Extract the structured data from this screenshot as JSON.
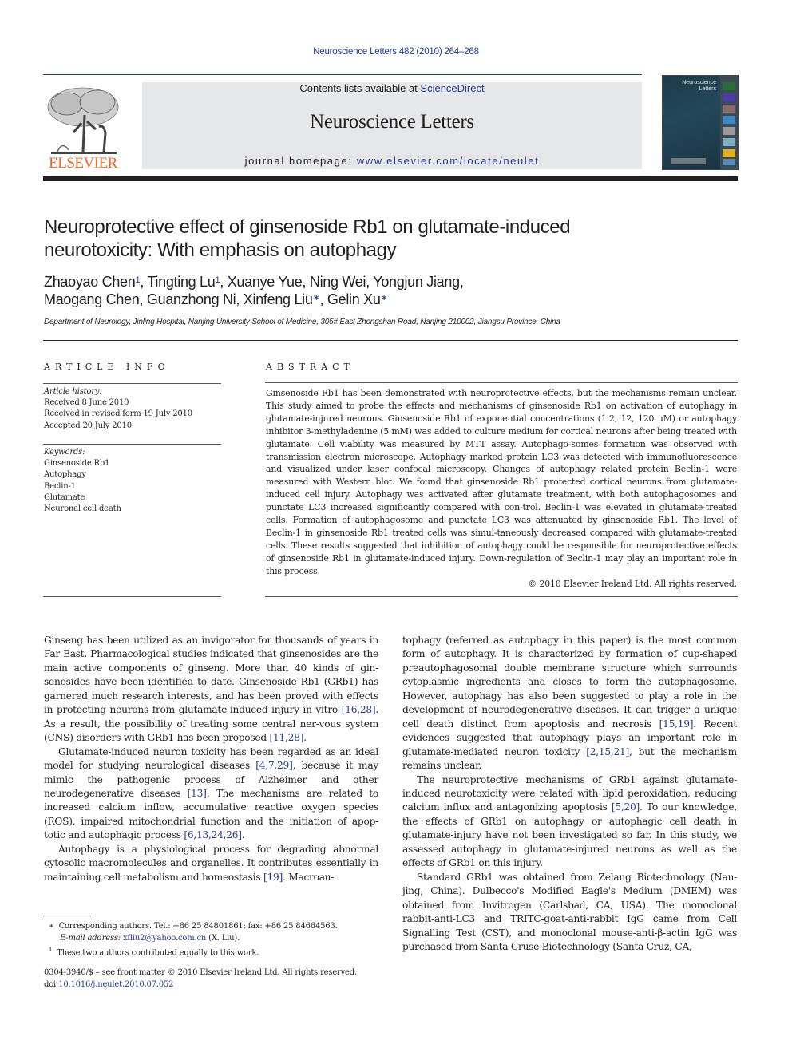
{
  "header": {
    "citation": "Neuroscience Letters 482 (2010) 264–268",
    "contents_prefix": "Contents lists available at ",
    "contents_link": "ScienceDirect",
    "journal_name": "Neuroscience Letters",
    "homepage_prefix": "journal homepage: ",
    "homepage_link": "www.elsevier.com/locate/neulet",
    "publisher_logo_text": "ELSEVIER",
    "cover_title_line1": "Neuroscience",
    "cover_title_line2": "Letters",
    "colors": {
      "link": "#2b3990",
      "publisher": "#f26522",
      "masthead_bg": "#e6e7e8"
    }
  },
  "article": {
    "title_line1": "Neuroprotective effect of ginsenoside Rb1 on glutamate-induced",
    "title_line2": "neurotoxicity: With emphasis on autophagy",
    "authors": [
      {
        "name": "Zhaoyao Chen",
        "mark": "1"
      },
      {
        "name": "Tingting Lu",
        "mark": "1"
      },
      {
        "name": "Xuanye Yue",
        "mark": ""
      },
      {
        "name": "Ning Wei",
        "mark": ""
      },
      {
        "name": "Yongjun Jiang",
        "mark": ""
      },
      {
        "name": "Maogang Chen",
        "mark": ""
      },
      {
        "name": "Guanzhong Ni",
        "mark": ""
      },
      {
        "name": "Xinfeng Liu",
        "mark": "∗"
      },
      {
        "name": "Gelin Xu",
        "mark": "∗"
      }
    ],
    "affiliation": "Department of Neurology, Jinling Hospital, Nanjing University School of Medicine, 305# East Zhongshan Road, Nanjing 210002, Jiangsu Province, China"
  },
  "article_info": {
    "heading": "ARTICLE INFO",
    "history_label": "Article history:",
    "history": [
      "Received 8 June 2010",
      "Received in revised form 19 July 2010",
      "Accepted 20 July 2010"
    ],
    "keywords_label": "Keywords:",
    "keywords": [
      "Ginsenoside Rb1",
      "Autophagy",
      "Beclin-1",
      "Glutamate",
      "Neuronal cell death"
    ]
  },
  "abstract": {
    "heading": "ABSTRACT",
    "text": "Ginsenoside Rb1 has been demonstrated with neuroprotective effects, but the mechanisms remain unclear. This study aimed to probe the effects and mechanisms of ginsenoside Rb1 on activation of autophagy in glutamate-injured neurons. Ginsenoside Rb1 of exponential concentrations (1.2, 12, 120 μM) or autophagy inhibitor 3-methyladenine (5 mM) was added to culture medium for cortical neurons after being treated with glutamate. Cell viability was measured by MTT assay. Autophago-somes formation was observed with transmission electron microscope. Autophagy marked protein LC3 was detected with immunofluorescence and visualized under laser confocal microscopy. Changes of autophagy related protein Beclin-1 were measured with Western blot. We found that ginsenoside Rb1 protected cortical neurons from glutamate-induced cell injury. Autophagy was activated after glutamate treatment, with both autophagosomes and punctate LC3 increased significantly compared with con-trol. Beclin-1 was elevated in glutamate-treated cells. Formation of autophagosome and punctate LC3 was attenuated by ginsenoside Rb1. The level of Beclin-1 in ginsenoside Rb1 treated cells was simul-taneously decreased compared with glutamate-treated cells. These results suggested that inhibition of autophagy could be responsible for neuroprotective effects of ginsenoside Rb1 in glutamate-induced injury. Down-regulation of Beclin-1 may play an important role in this process.",
    "copyright": "© 2010 Elsevier Ireland Ltd. All rights reserved."
  },
  "body": {
    "left": [
      {
        "parts": [
          "Ginseng has been utilized as an invigorator for thousands of years in Far East. Pharmacological studies indicated that ginsenosides are the main active components of ginseng. More than 40 kinds of gin-senosides have been identified to date. Ginsenoside Rb1 (GRb1) has garnered much research interests, and has been proved with effects in protecting neurons from glutamate-induced injury in vitro ",
          {
            "ref": "[16,28]"
          },
          ". As a result, the possibility of treating some central ner-vous system (CNS) disorders with GRb1 has been proposed ",
          {
            "ref": "[11,28]"
          },
          "."
        ]
      },
      {
        "parts": [
          "Glutamate-induced neuron toxicity has been regarded as an ideal model for studying neurological diseases ",
          {
            "ref": "[4,7,29]"
          },
          ", because it may mimic the pathogenic process of Alzheimer and other neurodegenerative diseases ",
          {
            "ref": "[13]"
          },
          ". The mechanisms are related to increased calcium inflow, accumulative reactive oxygen species (ROS), impaired mitochondrial function and the initiation of apop-totic and autophagic process ",
          {
            "ref": "[6,13,24,26]"
          },
          "."
        ]
      },
      {
        "parts": [
          "Autophagy is a physiological process for degrading abnormal cytosolic macromolecules and organelles. It contributes essentially in maintaining cell metabolism and homeostasis ",
          {
            "ref": "[19]"
          },
          ". Macroau-"
        ]
      }
    ],
    "right": [
      {
        "parts": [
          "tophagy (referred as autophagy in this paper) is the most common form of autophagy. It is characterized by formation of cup-shaped preautophagosomal double membrane structure which surrounds cytoplasmic ingredients and closes to form the autophagosome. However, autophagy has also been suggested to play a role in the development of neurodegenerative diseases. It can trigger a unique cell death distinct from apoptosis and necrosis ",
          {
            "ref": "[15,19]"
          },
          ". Recent evidences suggested that autophagy plays an important role in glutamate-mediated neuron toxicity ",
          {
            "ref": "[2,15,21]"
          },
          ", but the mechanism remains unclear."
        ]
      },
      {
        "parts": [
          "The neuroprotective mechanisms of GRb1 against glutamate-induced neurotoxicity were related with lipid peroxidation, reducing calcium influx and antagonizing apoptosis ",
          {
            "ref": "[5,20]"
          },
          ". To our knowledge, the effects of GRb1 on autophagy or autophagic cell death in glutamate-injury have not been investigated so far. In this study, we assessed autophagy in glutamate-injured neurons as well as the effects of GRb1 on this injury."
        ]
      },
      {
        "parts": [
          "Standard GRb1 was obtained from Zelang Biotechnology (Nan-jing, China). Dulbecco's Modified Eagle's Medium (DMEM) was obtained from Invitrogen (Carlsbad, CA, USA). The monoclonal rabbit-anti-LC3 and TRITC-goat-anti-rabbit IgG came from Cell Signalling Test (CST), and monoclonal mouse-anti-β-actin IgG was purchased from Santa Cruse Biotechnology (Santa Cruz, CA,"
        ]
      }
    ]
  },
  "footnotes": {
    "corresponding_mark": "∗",
    "corresponding": "Corresponding authors. Tel.: +86 25 84801861; fax: +86 25 84664563.",
    "email_label": "E-mail address:",
    "email": "xfliu2@yahoo.com.cn",
    "email_owner": "(X. Liu).",
    "equal_mark": "1",
    "equal": "These two authors contributed equally to this work."
  },
  "front_matter": {
    "issn_line": "0304-3940/$ – see front matter © 2010 Elsevier Ireland Ltd. All rights reserved.",
    "doi_label": "doi:",
    "doi": "10.1016/j.neulet.2010.07.052"
  }
}
